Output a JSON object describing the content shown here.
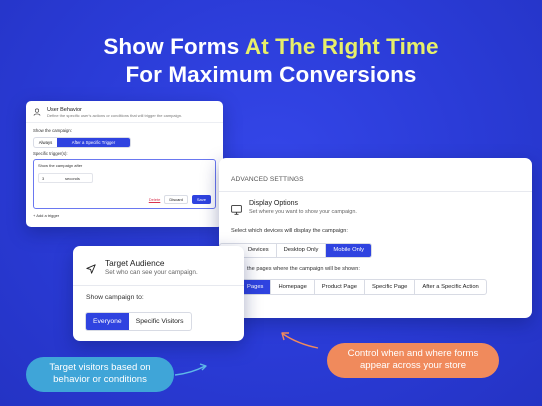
{
  "headline": {
    "line1_prefix": "Show Forms ",
    "line1_highlight": "At The Right Time",
    "line2": "For Maximum Conversions"
  },
  "colors": {
    "background": "#2a3bd6",
    "accent_yellow": "#e7ef6a",
    "primary_button": "#2f43e0",
    "callout_left": "#3fa5d8",
    "callout_right": "#f08a5c"
  },
  "user_behavior_card": {
    "icon": "user-icon",
    "title": "User Behavior",
    "description": "Define the specific user's actions or conditions that will trigger the campaign.",
    "show_label": "Show the campaign:",
    "options": [
      "Always",
      "After a Specific Trigger"
    ],
    "selected": "After a Specific Trigger",
    "triggers_label": "Specific trigger(s):",
    "trigger_text": "Show the campaign after",
    "trigger_value": "3",
    "trigger_unit": "seconds",
    "delete_label": "Delete",
    "discard_label": "Discard",
    "save_label": "Save",
    "add_trigger_label": "+ Add a trigger"
  },
  "advanced_settings_card": {
    "header": "ADVANCED SETTINGS",
    "display_icon": "monitor-icon",
    "display_title": "Display Options",
    "display_desc": "Set where you want to show your campaign.",
    "devices_label": "Select which devices will display the campaign:",
    "devices": [
      "Devices",
      "Desktop Only",
      "Mobile Only"
    ],
    "selected_device": "Mobile Only",
    "pages_label": "the pages where the campaign will be shown:",
    "pages": [
      "Pages",
      "Homepage",
      "Product Page",
      "Specific Page",
      "After a Specific Action"
    ],
    "selected_page": "Pages"
  },
  "target_audience_card": {
    "icon": "navigation-arrow-icon",
    "title": "Target Audience",
    "description": "Set who can see your campaign.",
    "show_label": "Show campaign to:",
    "options": [
      "Everyone",
      "Specific Visitors"
    ],
    "selected": "Everyone"
  },
  "callouts": {
    "left": [
      "Target visitors based on",
      "behavior or conditions"
    ],
    "right": [
      "Control when and where forms",
      "appear across your store"
    ]
  }
}
